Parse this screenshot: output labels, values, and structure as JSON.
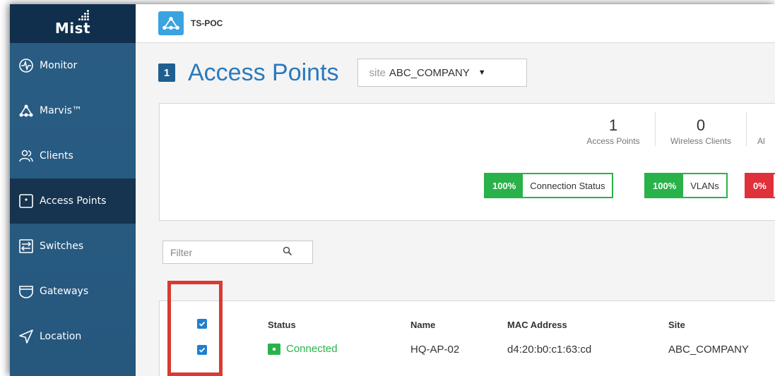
{
  "logo": {
    "text": "Mist"
  },
  "nav": [
    {
      "label": "Monitor",
      "icon": "monitor-icon"
    },
    {
      "label": "Marvis™",
      "icon": "marvis-icon"
    },
    {
      "label": "Clients",
      "icon": "clients-icon"
    },
    {
      "label": "Access Points",
      "icon": "access-point-icon"
    },
    {
      "label": "Switches",
      "icon": "switches-icon"
    },
    {
      "label": "Gateways",
      "icon": "gateways-icon"
    },
    {
      "label": "Location",
      "icon": "location-icon"
    }
  ],
  "topbar": {
    "org_name": "TS-POC"
  },
  "page": {
    "count": "1",
    "title": "Access Points",
    "site_prefix": "site",
    "site_value": "ABC_COMPANY"
  },
  "stats": [
    {
      "num": "1",
      "label": "Access Points"
    },
    {
      "num": "0",
      "label": "Wireless Clients"
    },
    {
      "num": "",
      "label": "Al"
    }
  ],
  "sle": [
    {
      "pct": "100%",
      "name": "Connection Status",
      "status": "good"
    },
    {
      "pct": "100%",
      "name": "VLANs",
      "status": "good"
    },
    {
      "pct": "0%",
      "name": "",
      "status": "bad"
    }
  ],
  "filter": {
    "placeholder": "Filter"
  },
  "table": {
    "headers": {
      "status": "Status",
      "name": "Name",
      "mac": "MAC Address",
      "site": "Site"
    },
    "rows": [
      {
        "status": "Connected",
        "name": "HQ-AP-02",
        "mac": "d4:20:b0:c1:63:cd",
        "site": "ABC_COMPANY",
        "checked": true
      }
    ]
  },
  "colors": {
    "accent": "#2a79bc",
    "good": "#2ab24a",
    "bad": "#e0303a",
    "highlight": "#d93a32"
  }
}
